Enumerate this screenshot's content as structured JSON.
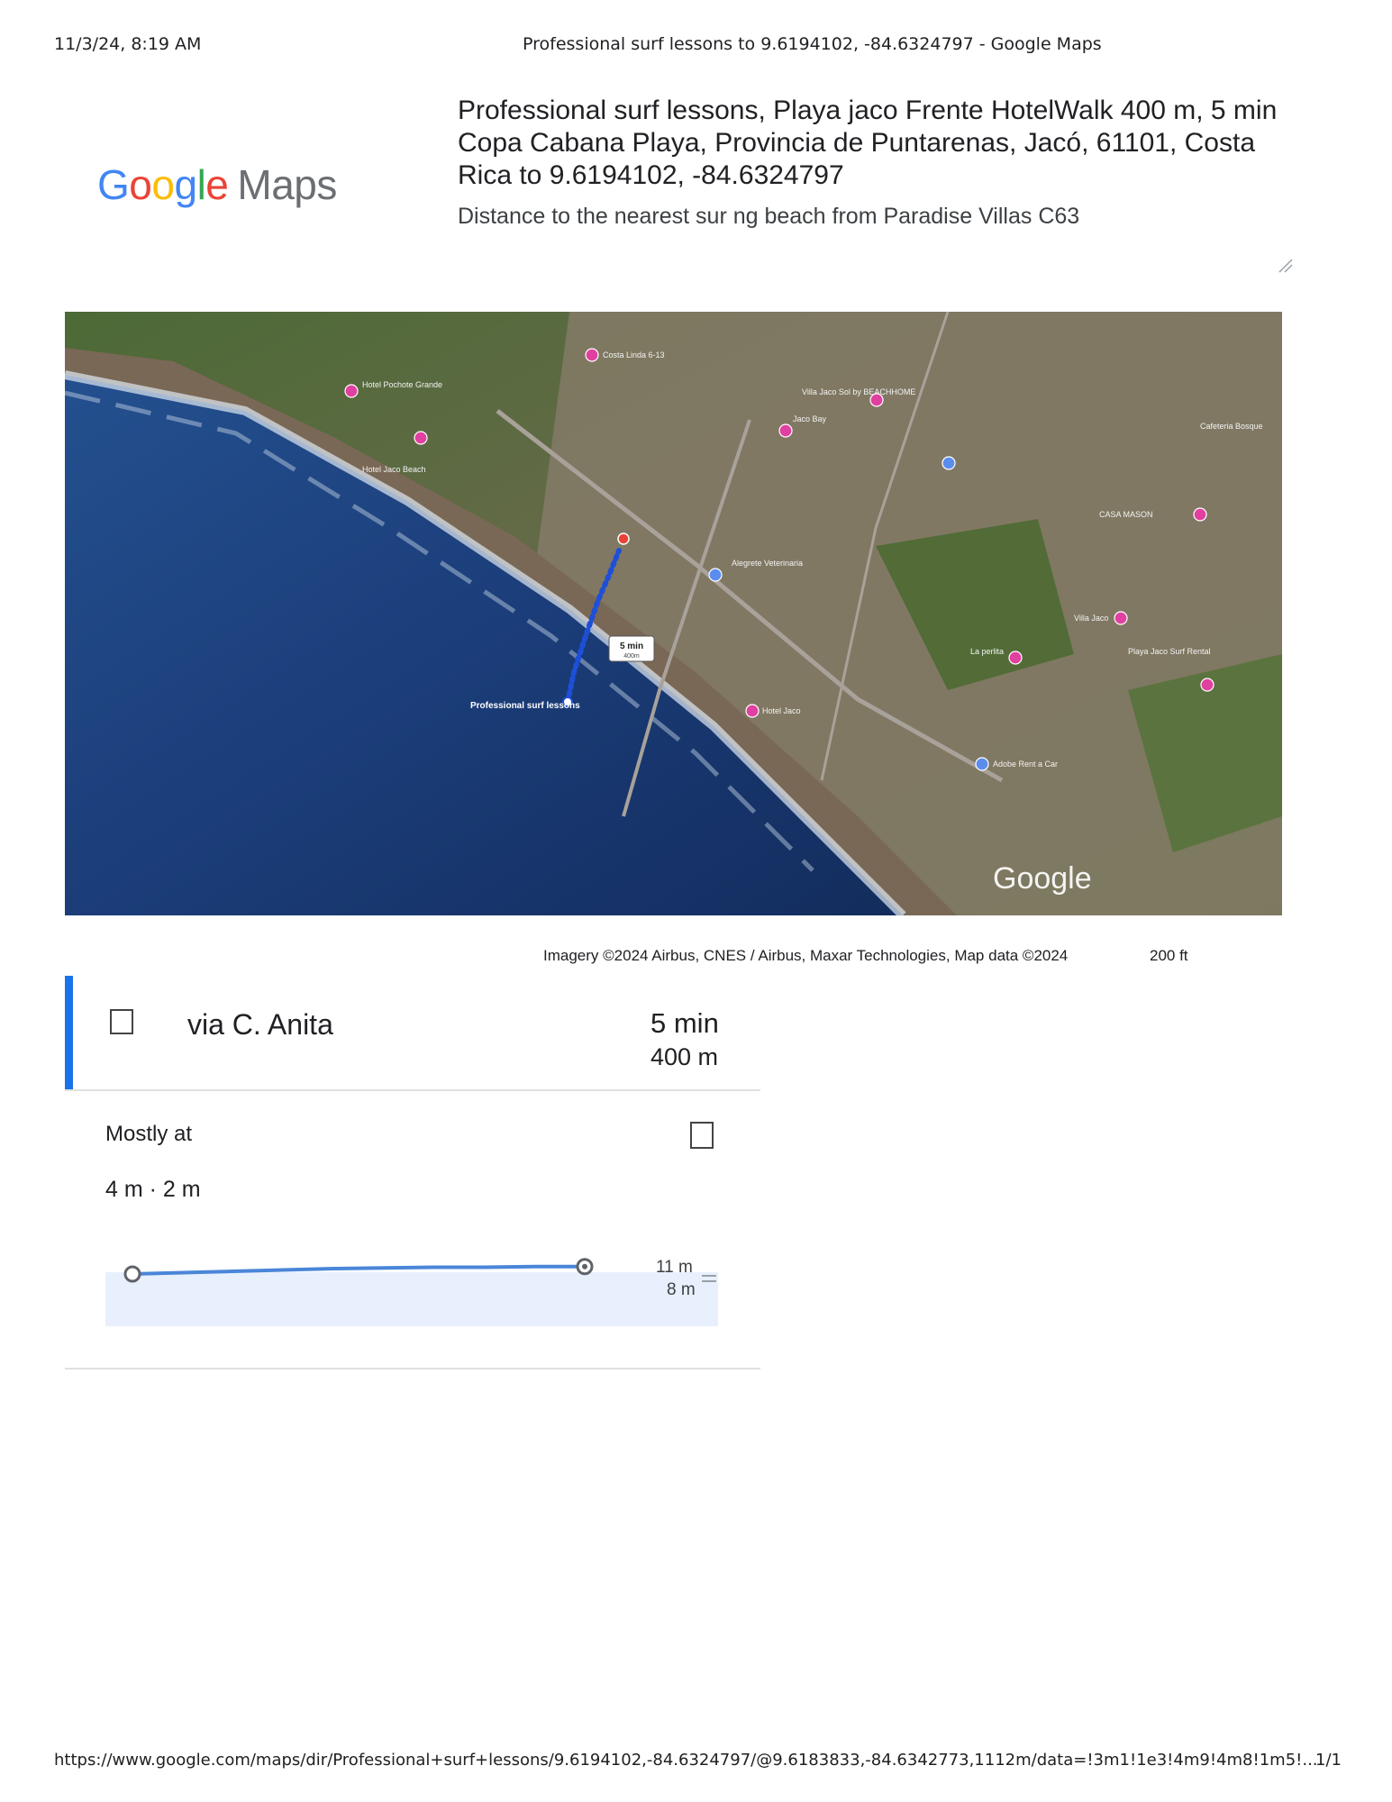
{
  "header": {
    "date": "11/3/24, 8:19 AM",
    "title": "Professional surf lessons to 9.6194102, -84.6324797 - Google Maps"
  },
  "logo": {
    "google_letters": [
      "G",
      "o",
      "o",
      "g",
      "l",
      "e"
    ],
    "google_colors": [
      "#4285f4",
      "#ea4335",
      "#fbbc05",
      "#4285f4",
      "#34a853",
      "#ea4335"
    ],
    "maps": "Maps"
  },
  "route": {
    "title": "Professional surf lessons, Playa jaco Frente HotelWalk 400 m, 5 min Copa Cabana Playa, Provincia de Puntarenas, Jacó, 61101, Costa Rica to 9.6194102, -84.6324797",
    "note": "Distance to the nearest sur ng beach from Paradise Villas C63"
  },
  "map": {
    "labels": {
      "walk_time": "5 min",
      "walk_dist": "400m",
      "origin": "Professional surf lessons",
      "google": "Google",
      "pois": [
        "Villa Jaco Sol by BEACHHOME",
        "Jaco Bay",
        "Hotel Jaco",
        "Cafeteria Bosque",
        "CASA MASON",
        "Villa Jaco",
        "La perlita",
        "Playa Jaco Surf Rental",
        "Adobe Rent a Car",
        "Costa Linda 6-13",
        "Hotel Pochote Grande",
        "Hotel Jaco Beach",
        "Alegrete Veterinaria"
      ]
    },
    "attribution": "Imagery ©2024 Airbus, CNES / Airbus, Maxar Technologies, Map data ©2024",
    "scale": "200 ft",
    "colors": {
      "route_blue": "#1a73e8",
      "route_dots": "#1e4fd8",
      "destination_red": "#ea4335",
      "ocean": "#1d3f7a"
    }
  },
  "directions": {
    "via": "via C. Anita",
    "time": "5 min",
    "distance": "400 m",
    "accent_color": "#1a73e8"
  },
  "elevation": {
    "summary": "Mostly at",
    "changes": "4 m · 2 m",
    "max_label": "11 m",
    "min_label": "8 m",
    "profile": [
      8.4,
      8.6,
      8.8,
      9.0,
      9.2,
      9.3,
      9.4,
      9.4,
      9.5,
      9.5
    ],
    "fill_color": "#e8f0fe",
    "line_color": "#4a86d8"
  },
  "footer": {
    "url": "https://www.google.com/maps/dir/Professional+surf+lessons/9.6194102,-84.6324797/@9.6183833,-84.6342773,1112m/data=!3m1!1e3!4m9!4m8!1m5!...",
    "page": "1/1"
  }
}
